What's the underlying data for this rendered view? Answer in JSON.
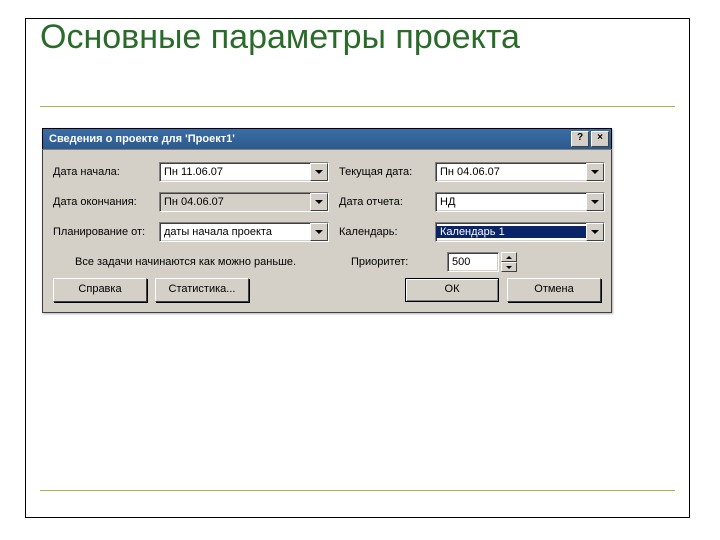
{
  "page": {
    "title": "Основные параметры проекта"
  },
  "dialog": {
    "title": "Сведения о проекте для 'Проект1'",
    "labels": {
      "start_date": "Дата начала:",
      "end_date": "Дата окончания:",
      "schedule_from": "Планирование от:",
      "current_date": "Текущая дата:",
      "report_date": "Дата отчета:",
      "calendar": "Календарь:",
      "priority": "Приоритет:"
    },
    "values": {
      "start_date": "Пн 11.06.07",
      "end_date": "Пн 04.06.07",
      "schedule_from": "даты начала проекта",
      "current_date": "Пн 04.06.07",
      "report_date": "НД",
      "calendar": "Календарь 1",
      "priority": "500"
    },
    "note": "Все задачи начинаются как можно раньше.",
    "buttons": {
      "help": "Справка",
      "stats": "Статистика...",
      "ok": "ОК",
      "cancel": "Отмена"
    },
    "titlebar_buttons": {
      "help": "?",
      "close": "×"
    }
  }
}
